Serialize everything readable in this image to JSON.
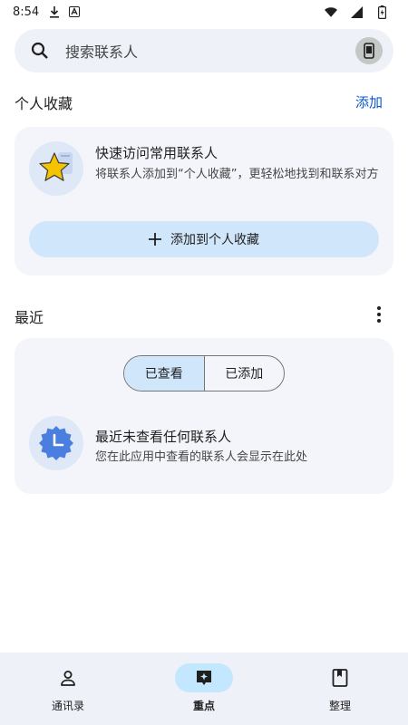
{
  "status_bar": {
    "time": "8:54"
  },
  "search": {
    "placeholder": "搜索联系人"
  },
  "favorites": {
    "title": "个人收藏",
    "add_label": "添加",
    "card_title": "快速访问常用联系人",
    "card_desc": "将联系人添加到“个人收藏”，更轻松地找到和联系对方",
    "button_label": "添加到个人收藏"
  },
  "recent": {
    "title": "最近",
    "segments": [
      "已查看",
      "已添加"
    ],
    "empty_title": "最近未查看任何联系人",
    "empty_desc": "您在此应用中查看的联系人会显示在此处"
  },
  "bottom_nav": {
    "items": [
      {
        "label": "通讯录",
        "icon": "person-icon",
        "active": false
      },
      {
        "label": "重点",
        "icon": "highlights-icon",
        "active": true
      },
      {
        "label": "整理",
        "icon": "organize-icon",
        "active": false
      }
    ]
  },
  "colors": {
    "accent": "#0b57d0",
    "card_bg": "#f3f5fa",
    "tonal_button": "#cfe6fb",
    "nav_active": "#c2e7ff",
    "star": "#f5c400",
    "clock_badge": "#4a7fe0"
  }
}
